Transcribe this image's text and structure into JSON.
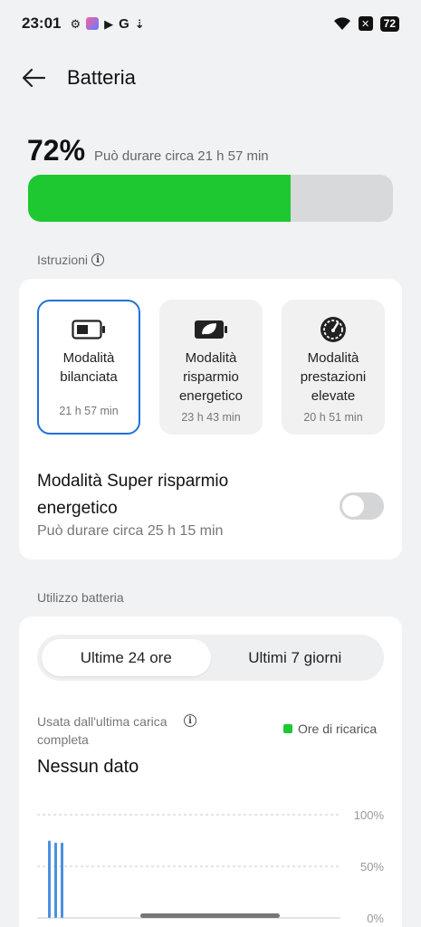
{
  "status_bar": {
    "time": "23:01",
    "left_icons": [
      "gear-icon",
      "app-icon",
      "play-icon",
      "google-icon",
      "vpn-icon"
    ],
    "battery": "72"
  },
  "header": {
    "title": "Batteria"
  },
  "battery": {
    "percent_label": "72%",
    "level": 72,
    "estimate": "Può durare circa 21 h 57 min",
    "fill_color": "#1ec830"
  },
  "instructions_label": "Istruzioni",
  "modes": [
    {
      "line1": "Modalità",
      "line2": "bilanciata",
      "line3": "",
      "time": "21 h 57 min",
      "selected": true
    },
    {
      "line1": "Modalità",
      "line2": "risparmio",
      "line3": "energetico",
      "time": "23 h 43 min",
      "selected": false
    },
    {
      "line1": "Modalità",
      "line2": "prestazioni",
      "line3": "elevate",
      "time": "20 h 51 min",
      "selected": false
    }
  ],
  "super_saver": {
    "title": "Modalità Super risparmio energetico",
    "subtitle": "Può durare circa 25 h 15 min",
    "enabled": false
  },
  "usage_section_label": "Utilizzo batteria",
  "usage": {
    "tabs": [
      "Ultime 24 ore",
      "Ultimi 7 giorni"
    ],
    "active_tab": 0,
    "used_since_label": "Usata dall'ultima carica completa",
    "legend": "Ore di ricarica",
    "no_data": "Nessun dato"
  },
  "chart_data": {
    "type": "bar",
    "y_ticks": [
      "100%",
      "50%",
      "0%"
    ],
    "ylim": [
      0,
      100
    ],
    "series": [
      {
        "values": [
          75,
          73,
          73
        ]
      }
    ],
    "bar_color": "#4a90e2"
  },
  "colors": {
    "accent": "#1f72d9",
    "charge": "#1ec830"
  }
}
